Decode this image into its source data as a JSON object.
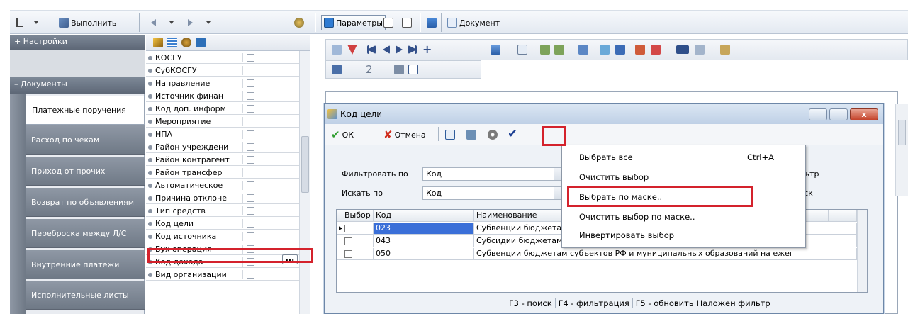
{
  "toolbar": {
    "execute_label": "Выполнить",
    "params_label": "Параметры",
    "document_label": "Документ"
  },
  "sidebar": {
    "settings_header": "Настройки",
    "documents_header": "Документы",
    "items": [
      {
        "label": "Платежные поручения"
      },
      {
        "label": "Расход по чекам"
      },
      {
        "label": "Приход от прочих"
      },
      {
        "label": "Возврат по объявлениям"
      },
      {
        "label": "Переброска между Л/С"
      },
      {
        "label": "Внутренние платежи"
      },
      {
        "label": "Исполнительные листы"
      }
    ]
  },
  "fields": {
    "items": [
      {
        "label": "КОСГУ"
      },
      {
        "label": "СубКОСГУ"
      },
      {
        "label": "Направление"
      },
      {
        "label": "Источник финан"
      },
      {
        "label": "Код доп. информ"
      },
      {
        "label": "Мероприятие"
      },
      {
        "label": "НПА"
      },
      {
        "label": "Район учреждени"
      },
      {
        "label": "Район контрагент"
      },
      {
        "label": "Район трансфер"
      },
      {
        "label": "Автоматическое"
      },
      {
        "label": "Причина отклоне"
      },
      {
        "label": "Тип средств"
      },
      {
        "label": "Код цели"
      },
      {
        "label": "Код источника"
      },
      {
        "label": "Бух операция"
      },
      {
        "label": "Код дохода"
      },
      {
        "label": "Вид организации"
      }
    ],
    "ellipsis": "..."
  },
  "main": {
    "record_number": "2"
  },
  "dialog": {
    "title": "Код цели",
    "ok_label": "ОК",
    "cancel_label": "Отмена",
    "filter_by_label": "Фильтровать по",
    "filter_by_value": "Код",
    "search_by_label": "Искать по",
    "search_by_value": "Код",
    "filter_button": "Фильтр",
    "search_button": "Поиск",
    "grid": {
      "columns": [
        "Выбор",
        "Код",
        "Наименование"
      ],
      "rows": [
        {
          "code": "023",
          "name": "Субвенции бюджетам субъектов Российской Федерации и муниципальных"
        },
        {
          "code": "043",
          "name": "Субсидии бюджетам субъектов Российской Федерации и муниципальных о"
        },
        {
          "code": "050",
          "name": "Субвенции бюджетам субъектов РФ и муниципальных образований на ежег"
        }
      ]
    },
    "status": {
      "search": "F3 - поиск",
      "filter": "F4 - фильтрация",
      "refresh": "F5 - обновить",
      "applied": "Наложен фильтр"
    }
  },
  "menu": {
    "select_all": "Выбрать все",
    "select_all_shortcut": "Ctrl+A",
    "clear_selection": "Очистить выбор",
    "select_by_mask": "Выбрать по маске..",
    "clear_by_mask": "Очистить выбор по маске..",
    "invert_selection": "Инвертировать выбор"
  },
  "colors": {
    "highlight": "#d4222c",
    "nav_item": "#7f8997",
    "selected_row": "#3a6fd8"
  }
}
